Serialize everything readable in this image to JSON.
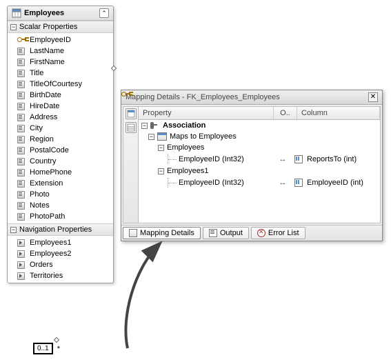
{
  "entity": {
    "title": "Employees",
    "sections": {
      "scalar": {
        "header": "Scalar Properties",
        "items": [
          {
            "label": "EmployeeID",
            "key": true
          },
          {
            "label": "LastName",
            "key": false
          },
          {
            "label": "FirstName",
            "key": false
          },
          {
            "label": "Title",
            "key": false
          },
          {
            "label": "TitleOfCourtesy",
            "key": false
          },
          {
            "label": "BirthDate",
            "key": false
          },
          {
            "label": "HireDate",
            "key": false
          },
          {
            "label": "Address",
            "key": false
          },
          {
            "label": "City",
            "key": false
          },
          {
            "label": "Region",
            "key": false
          },
          {
            "label": "PostalCode",
            "key": false
          },
          {
            "label": "Country",
            "key": false
          },
          {
            "label": "HomePhone",
            "key": false
          },
          {
            "label": "Extension",
            "key": false
          },
          {
            "label": "Photo",
            "key": false
          },
          {
            "label": "Notes",
            "key": false
          },
          {
            "label": "PhotoPath",
            "key": false
          }
        ]
      },
      "nav": {
        "header": "Navigation Properties",
        "items": [
          {
            "label": "Employees1"
          },
          {
            "label": "Employees2"
          },
          {
            "label": "Orders"
          },
          {
            "label": "Territories"
          }
        ]
      }
    }
  },
  "mapping": {
    "title": "Mapping Details - FK_Employees_Employees",
    "columns": {
      "prop": "Property",
      "op": "O..",
      "col": "Column"
    },
    "tree": {
      "root": "Association",
      "mapsTo": "Maps to Employees",
      "end1": {
        "name": "Employees",
        "prop": "EmployeeID (Int32)",
        "col": "ReportsTo (int)"
      },
      "end2": {
        "name": "Employees1",
        "prop": "EmployeeID (Int32)",
        "col": "EmployeeID (int)"
      }
    },
    "tabs": {
      "mapping": "Mapping Details",
      "output": "Output",
      "errors": "Error List"
    }
  },
  "multiplicity": {
    "left": "0..1",
    "right": "*"
  }
}
